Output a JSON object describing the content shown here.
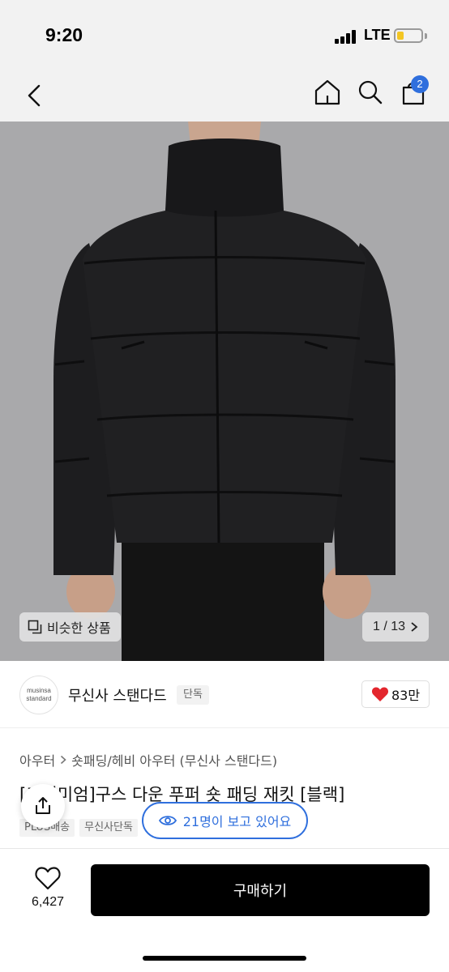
{
  "status_bar": {
    "time": "9:20",
    "network": "LTE",
    "battery_color": "#f3c623"
  },
  "nav": {
    "back_icon": "chevron-left-icon",
    "home_icon": "home-icon",
    "search_icon": "search-icon",
    "cart_icon": "shopping-bag-icon",
    "cart_badge": "2",
    "badge_color": "#2f6fdd"
  },
  "gallery": {
    "similar_label": "비슷한 상품",
    "page_indicator": "1 / 13",
    "image_background": "#a8a8aa"
  },
  "brand": {
    "logo_line1": "musinsa",
    "logo_line2": "standard",
    "name": "무신사 스탠다드",
    "exclusive_label": "단독",
    "like_count": "83만",
    "like_color": "#e3262d"
  },
  "product": {
    "breadcrumb": [
      "아우터",
      "숏패딩/헤비 아우터 (무신사 스탠다드)"
    ],
    "title": "[프리미엄]구스 다운 푸퍼 숏 패딩 재킷 [블랙]",
    "tags": [
      "PLUS배송",
      "무신사단독"
    ]
  },
  "overlay": {
    "viewers_text": "21명이 보고 있어요",
    "share_icon": "share-icon"
  },
  "bottom_bar": {
    "wish_count": "6,427",
    "buy_label": "구매하기"
  }
}
